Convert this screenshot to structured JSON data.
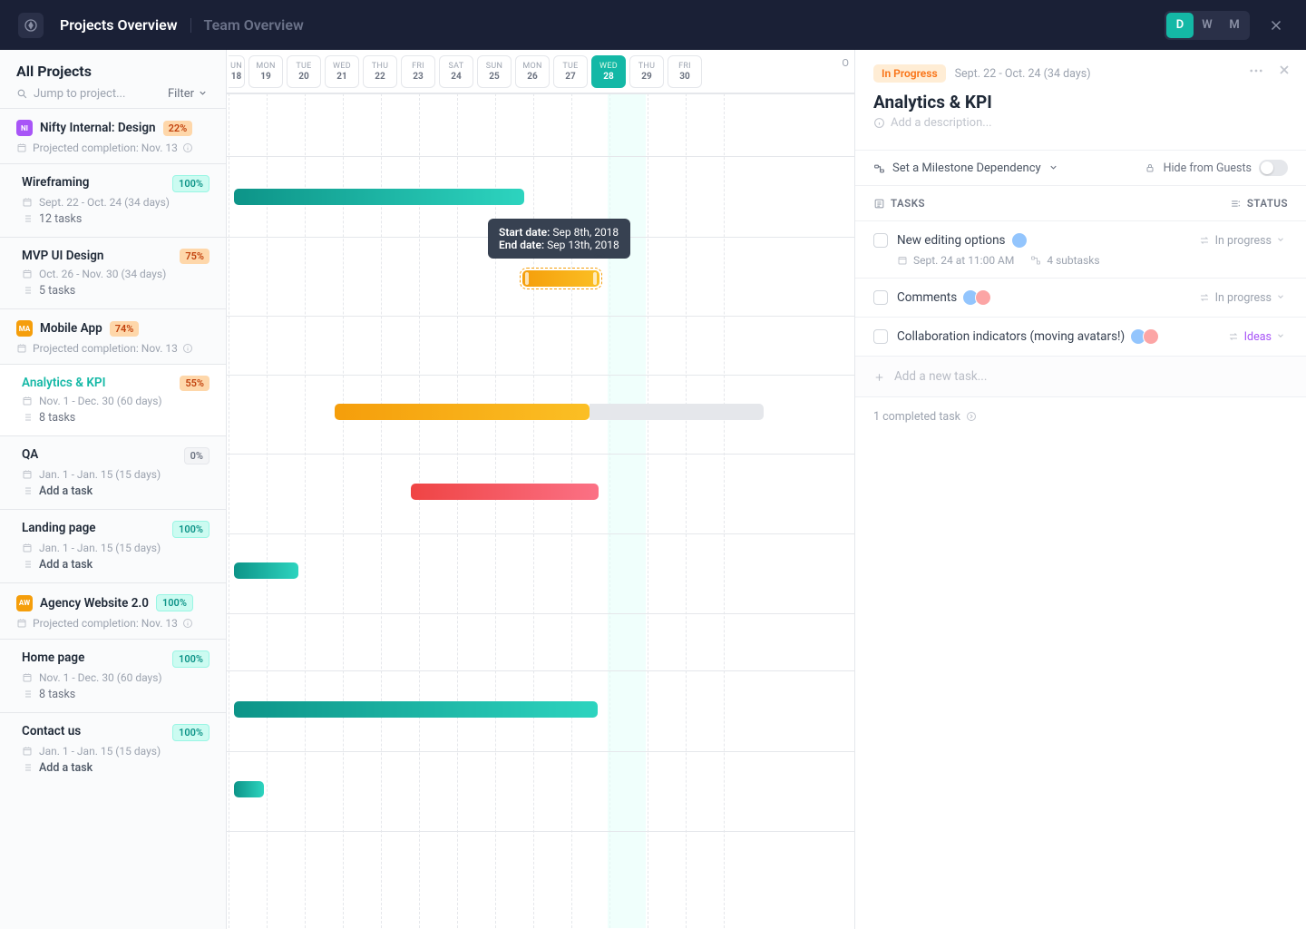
{
  "header": {
    "tabs": [
      "Projects Overview",
      "Team Overview"
    ],
    "active_tab": 0,
    "view_modes": [
      "D",
      "W",
      "M"
    ],
    "active_mode": 0
  },
  "sidebar": {
    "title": "All Projects",
    "search_placeholder": "Jump to project...",
    "filter_label": "Filter",
    "groups": [
      {
        "icon": "NI",
        "icon_color": "#a855f7",
        "name": "Nifty Internal: Design",
        "pct": "22%",
        "meta": "Projected completion: Nov. 13",
        "milestones": [
          {
            "name": "Wireframing",
            "pct": "100%",
            "pct_style": "teal",
            "date": "Sept. 22 - Oct. 24 (34 days)",
            "sub": "12 tasks"
          },
          {
            "name": "MVP UI Design",
            "pct": "75%",
            "pct_style": "orange",
            "date": "Oct. 26 - Nov. 30 (34 days)",
            "sub": "5 tasks"
          }
        ]
      },
      {
        "icon": "MA",
        "icon_color": "#f59e0b",
        "name": "Mobile App",
        "pct": "74%",
        "meta": "Projected completion: Nov. 13",
        "milestones": [
          {
            "name": "Analytics & KPI",
            "pct": "55%",
            "pct_style": "orange",
            "date": "Nov. 1 - Dec. 30 (60 days)",
            "sub": "8 tasks",
            "active": true
          },
          {
            "name": "QA",
            "pct": "0%",
            "pct_style": "gray",
            "date": "Jan. 1 - Jan. 15 (15 days)",
            "sub": "Add a task",
            "sub_action": true
          },
          {
            "name": "Landing page",
            "pct": "100%",
            "pct_style": "teal",
            "date": "Jan. 1 - Jan. 15 (15 days)",
            "sub": "Add a task",
            "sub_action": true
          }
        ]
      },
      {
        "icon": "AW",
        "icon_color": "#f59e0b",
        "name": "Agency Website 2.0",
        "pct": "100%",
        "pct_style_override": "teal",
        "meta": "Projected completion: Nov. 13",
        "milestones": [
          {
            "name": "Home page",
            "pct": "100%",
            "pct_style": "teal",
            "date": "Nov. 1 - Dec. 30 (60 days)",
            "sub": "8 tasks"
          },
          {
            "name": "Contact us",
            "pct": "100%",
            "pct_style": "teal",
            "date": "Jan. 1 - Jan. 15 (15 days)",
            "sub": "Add a task",
            "sub_action": true
          }
        ]
      }
    ]
  },
  "timeline": {
    "overflow_char": "O",
    "days": [
      {
        "wk": "UN",
        "day": "18",
        "partial": true
      },
      {
        "wk": "MON",
        "day": "19"
      },
      {
        "wk": "TUE",
        "day": "20"
      },
      {
        "wk": "WED",
        "day": "21"
      },
      {
        "wk": "THU",
        "day": "22"
      },
      {
        "wk": "FRI",
        "day": "23"
      },
      {
        "wk": "SAT",
        "day": "24"
      },
      {
        "wk": "SUN",
        "day": "25"
      },
      {
        "wk": "MON",
        "day": "26"
      },
      {
        "wk": "TUE",
        "day": "27"
      },
      {
        "wk": "WED",
        "day": "28",
        "today": true
      },
      {
        "wk": "THU",
        "day": "29"
      },
      {
        "wk": "FRI",
        "day": "30"
      }
    ],
    "tooltip": {
      "start_label": "Start date:",
      "start_value": "Sep 8th, 2018",
      "end_label": "End date:",
      "end_value": "Sep 13th, 2018"
    }
  },
  "detail": {
    "status": "In Progress",
    "date_range": "Sept. 22 - Oct. 24 (34 days)",
    "title": "Analytics & KPI",
    "desc_placeholder": "Add a description...",
    "dependency_label": "Set a Milestone Dependency",
    "hide_guests_label": "Hide from Guests",
    "tasks_header": "TASKS",
    "status_header": "STATUS",
    "tasks": [
      {
        "name": "New editing options",
        "avatars": 1,
        "status": "In progress",
        "due": "Sept. 24 at 11:00 AM",
        "subtasks": "4 subtasks"
      },
      {
        "name": "Comments",
        "avatars": 2,
        "status": "In progress"
      },
      {
        "name": "Collaboration indicators (moving avatars!)",
        "avatars": 2,
        "status": "Ideas",
        "status_color": "#a855f7"
      }
    ],
    "add_task_label": "Add a new task...",
    "completed_label": "1 completed task"
  }
}
